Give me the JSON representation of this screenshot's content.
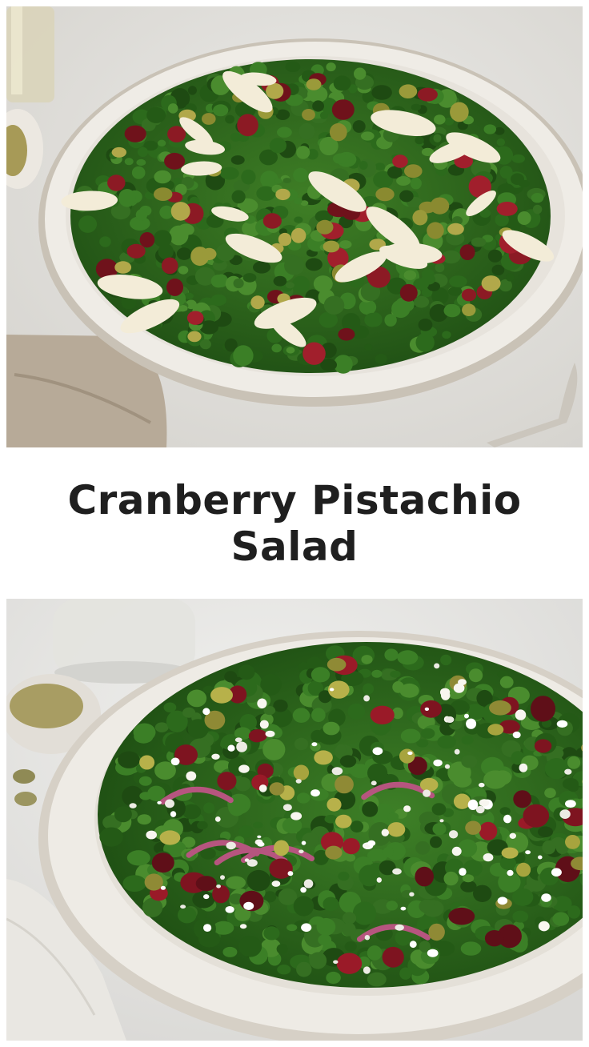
{
  "title": "Cranberry Pistachio Salad",
  "images": {
    "top": {
      "alt": "Kale salad with dried cranberries, pistachios and shaved parmesan in a white bowl",
      "colors": {
        "background": "#e4e3df",
        "bowl": "#efece6",
        "bowl_rim": "#c9c2b6",
        "kale": "#2f6a1e",
        "cranberry": "#8c1a24",
        "pistachio": "#9a9a3a",
        "parmesan": "#f3ecd8",
        "napkin": "#b7aa98"
      }
    },
    "bottom": {
      "alt": "Kale salad with dried cranberries, pistachios, feta crumbles and red onion in a speckled bowl",
      "colors": {
        "background": "#e8e8e6",
        "bowl": "#eeebe5",
        "bowl_rim": "#d6d0c6",
        "kale": "#2d6b1f",
        "cranberry": "#7e1420",
        "pistachio": "#a7a43e",
        "feta": "#f8f6f0",
        "onion": "#b6557f",
        "napkin": "#e9e7e2"
      }
    }
  }
}
